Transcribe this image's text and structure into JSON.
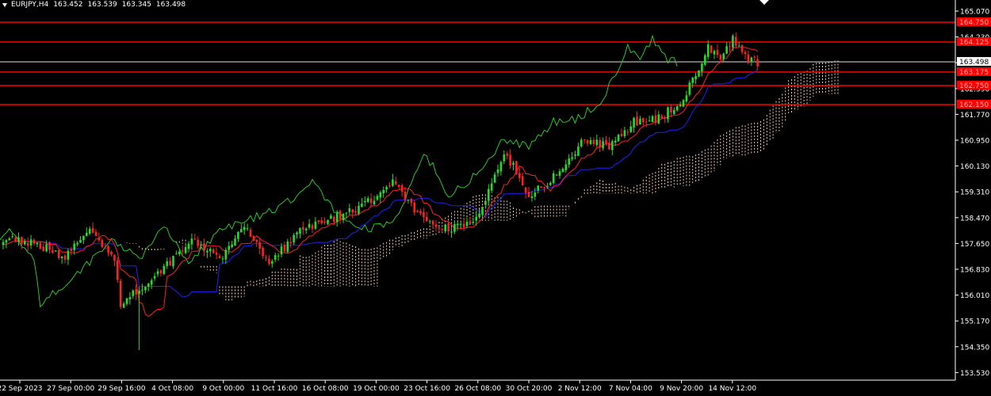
{
  "header": {
    "symbol": "EURJPY,H4",
    "open": "163.452",
    "high": "163.539",
    "low": "163.345",
    "close": "163.498"
  },
  "chart_data": {
    "type": "candlestick",
    "ylim": [
      153.45,
      165.45
    ],
    "y_ticks": [
      "165.070",
      "164.230",
      "163.410",
      "162.590",
      "161.770",
      "160.950",
      "160.130",
      "159.310",
      "158.470",
      "157.650",
      "156.830",
      "156.010",
      "155.170",
      "154.350",
      "153.530"
    ],
    "x_ticks": [
      "22 Sep 2023",
      "27 Sep 00:00",
      "29 Sep 16:00",
      "4 Oct 08:00",
      "9 Oct 00:00",
      "11 Oct 16:00",
      "16 Oct 08:00",
      "19 Oct 00:00",
      "23 Oct 16:00",
      "26 Oct 08:00",
      "30 Oct 20:00",
      "2 Nov 12:00",
      "7 Nov 04:00",
      "9 Nov 20:00",
      "14 Nov 12:00"
    ],
    "current_price": {
      "value": 163.498,
      "label": "163.498"
    },
    "levels": [
      {
        "value": 164.75,
        "label": "164.750"
      },
      {
        "value": 164.125,
        "label": "164.125"
      },
      {
        "value": 163.175,
        "label": "163.175"
      },
      {
        "value": 162.75,
        "label": "162.750"
      },
      {
        "value": 162.15,
        "label": "162.150"
      }
    ],
    "anchors": [
      [
        0,
        157.95
      ],
      [
        10,
        157.8
      ],
      [
        20,
        157.3
      ],
      [
        28,
        158.25
      ],
      [
        36,
        157.3
      ],
      [
        38,
        155.8
      ],
      [
        46,
        156.5
      ],
      [
        54,
        157.2
      ],
      [
        62,
        157.9
      ],
      [
        70,
        157.2
      ],
      [
        78,
        158.4
      ],
      [
        86,
        157.1
      ],
      [
        96,
        158.2
      ],
      [
        106,
        158.55
      ],
      [
        116,
        158.9
      ],
      [
        126,
        159.7
      ],
      [
        134,
        158.7
      ],
      [
        144,
        158.2
      ],
      [
        154,
        158.6
      ],
      [
        162,
        160.7
      ],
      [
        170,
        159.3
      ],
      [
        180,
        160.0
      ],
      [
        188,
        161.1
      ],
      [
        196,
        160.8
      ],
      [
        204,
        161.6
      ],
      [
        212,
        161.7
      ],
      [
        220,
        162.3
      ],
      [
        228,
        164.0
      ],
      [
        232,
        163.6
      ],
      [
        236,
        164.25
      ],
      [
        240,
        163.8
      ],
      [
        241,
        163.6
      ],
      [
        244,
        163.45
      ]
    ],
    "ichimoku": {
      "tenkan_color": "#ff1f1f",
      "kijun_color": "#2020ff",
      "chikou_color": "#22dd22",
      "cloud_color": "#f4c8a8"
    },
    "colors": {
      "bull": "#22dd22",
      "bear": "#ff2020",
      "level": "#ff0000",
      "price_line": "#ffffff",
      "axis_text": "#ffffff"
    }
  }
}
